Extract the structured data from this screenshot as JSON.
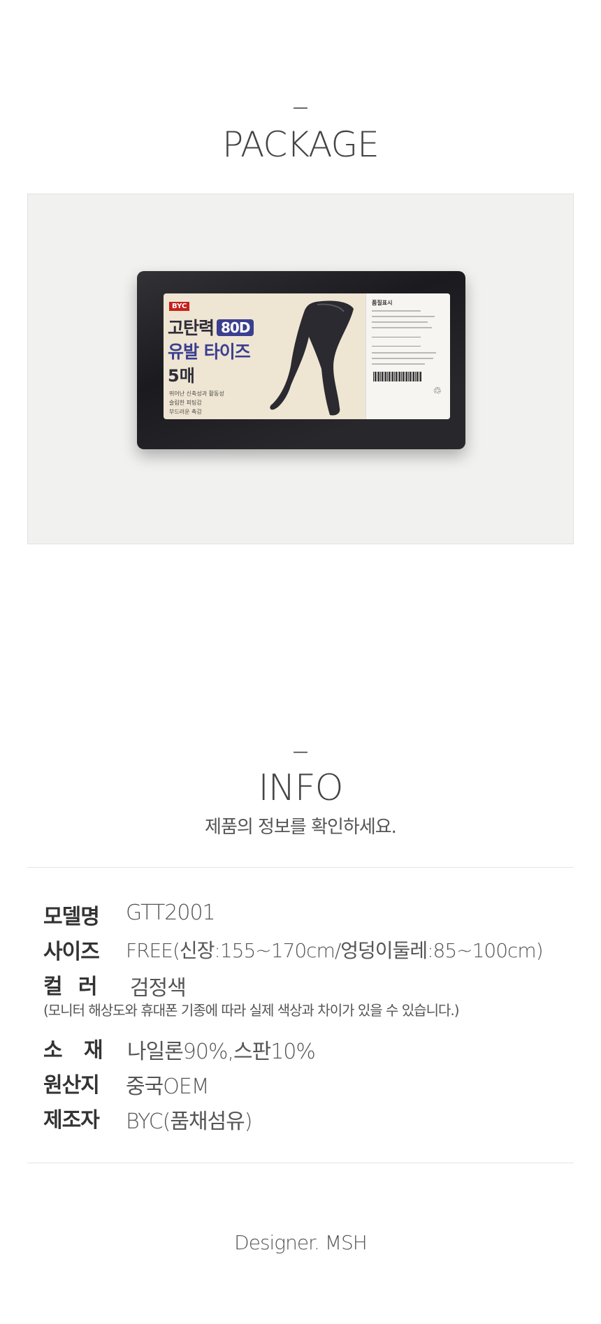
{
  "package_section": {
    "dash": "—",
    "title": "PACKAGE"
  },
  "package_photo": {
    "brand": "BYC",
    "line1": "고탄력",
    "badge": "80D",
    "line2": "유발 타이즈",
    "line3": "5매",
    "features": [
      "뛰어난 신축성과 활동성",
      "슬림한 피팅감",
      "부드러운 촉감"
    ],
    "info_heading": "품질표시"
  },
  "info_section": {
    "dash": "—",
    "title": "INFO",
    "subtitle": "제품의 정보를 확인하세요."
  },
  "specs": {
    "model_label": "모델명",
    "model_value": "GTT2001",
    "size_label": "사이즈",
    "size_value": "FREE(신장:155~170cm/엉덩이둘레:85~100cm)",
    "color_label": "컬  러",
    "color_value": "검정색",
    "color_note": "(모니터 해상도와 휴대폰 기종에 따라 실제 색상과 차이가 있을 수 있습니다.)",
    "material_label": "소  재",
    "material_value": "나일론90%,스판10%",
    "origin_label": "원산지",
    "origin_value": "중국OEM",
    "maker_label": "제조자",
    "maker_value": "BYC(품채섬유)"
  },
  "footer": {
    "designer": "Designer. MSH"
  }
}
